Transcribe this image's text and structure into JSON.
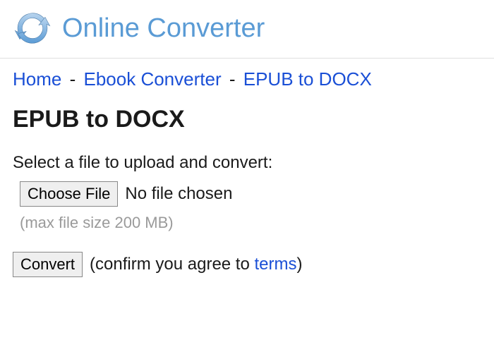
{
  "header": {
    "site_title": "Online Converter"
  },
  "breadcrumb": {
    "home": "Home",
    "sep": "-",
    "category": "Ebook Converter",
    "current": "EPUB to DOCX"
  },
  "page": {
    "title": "EPUB to DOCX",
    "instruction": "Select a file to upload and convert:",
    "choose_file_label": "Choose File",
    "file_status": "No file chosen",
    "max_size_note": "(max file size 200 MB)",
    "convert_label": "Convert",
    "agree_prefix": "(confirm you agree to ",
    "terms_label": "terms",
    "agree_suffix": ")"
  }
}
